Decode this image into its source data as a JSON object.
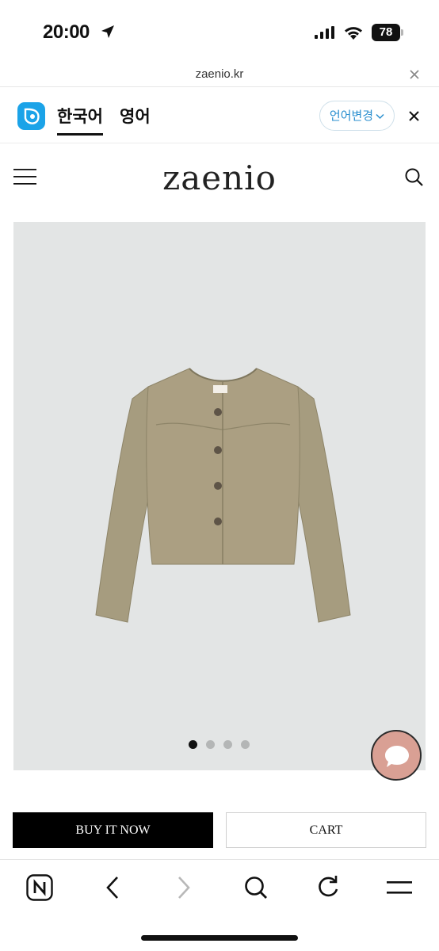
{
  "status_bar": {
    "time": "20:00",
    "battery": "78"
  },
  "url_bar": {
    "domain": "zaenio.kr"
  },
  "translate_bar": {
    "tab_korean": "한국어",
    "tab_english": "영어",
    "change_language_label": "언어변경"
  },
  "site": {
    "logo": "zaenio"
  },
  "carousel": {
    "total_slides": 4,
    "active_slide": 1
  },
  "colors": {
    "buy_now_bg": "#000000",
    "chat_button": "#d9a094",
    "papago_blue": "#1ba3e8",
    "accent_blue": "#2a8fcf",
    "jacket": "#a69c7f"
  },
  "actions": {
    "buy_now_label": "BUY IT NOW",
    "cart_label": "CART"
  },
  "toolbar": {
    "icons": [
      "naver-home-icon",
      "back-icon",
      "forward-icon",
      "search-icon",
      "reload-icon",
      "menu-icon"
    ]
  }
}
